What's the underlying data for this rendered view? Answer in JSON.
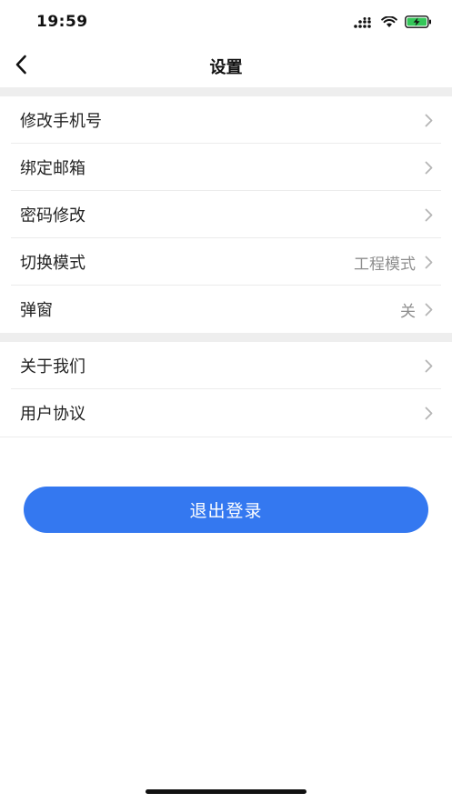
{
  "status_bar": {
    "time": "19:59",
    "signal_icon": "signal-dots-icon",
    "wifi_icon": "wifi-icon",
    "battery_icon": "battery-charging-icon"
  },
  "nav": {
    "title": "设置",
    "back_icon": "chevron-left-icon"
  },
  "groups": [
    {
      "items": [
        {
          "label": "修改手机号",
          "value": ""
        },
        {
          "label": "绑定邮箱",
          "value": ""
        },
        {
          "label": "密码修改",
          "value": ""
        },
        {
          "label": "切换模式",
          "value": "工程模式"
        },
        {
          "label": "弹窗",
          "value": "关"
        }
      ]
    },
    {
      "items": [
        {
          "label": "关于我们",
          "value": ""
        },
        {
          "label": "用户协议",
          "value": ""
        }
      ]
    }
  ],
  "logout": {
    "label": "退出登录"
  },
  "colors": {
    "accent": "#3478f0",
    "separator": "#eeeeee",
    "battery": "#34c759"
  }
}
